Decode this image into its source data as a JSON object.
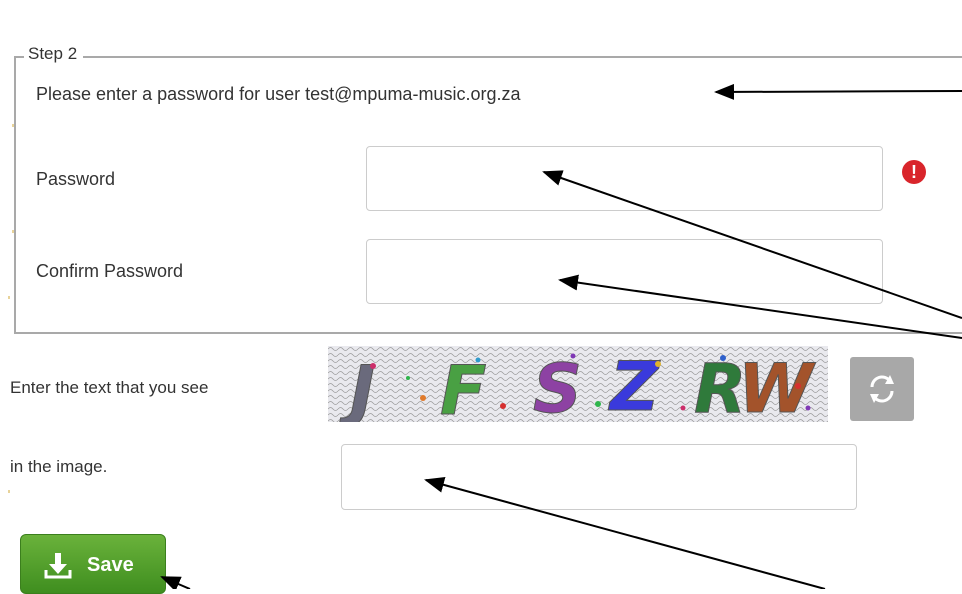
{
  "step": {
    "legend": "Step 2",
    "instruction": "Please enter a password for user test@mpuma-music.org.za"
  },
  "fields": {
    "password": {
      "label": "Password",
      "value": ""
    },
    "confirm_password": {
      "label": "Confirm Password",
      "value": ""
    }
  },
  "captcha": {
    "label_line1": "Enter the text that you see",
    "label_line2": "in the image.",
    "image_text": "JFSZRW",
    "value": ""
  },
  "buttons": {
    "save_label": "Save",
    "refresh_icon": "refresh-icon"
  },
  "icons": {
    "error": "exclamation-circle-icon",
    "save": "download-icon"
  },
  "colors": {
    "error": "#d9252b",
    "save_button": "#4c9a26",
    "refresh_button": "#a8a8a8"
  }
}
